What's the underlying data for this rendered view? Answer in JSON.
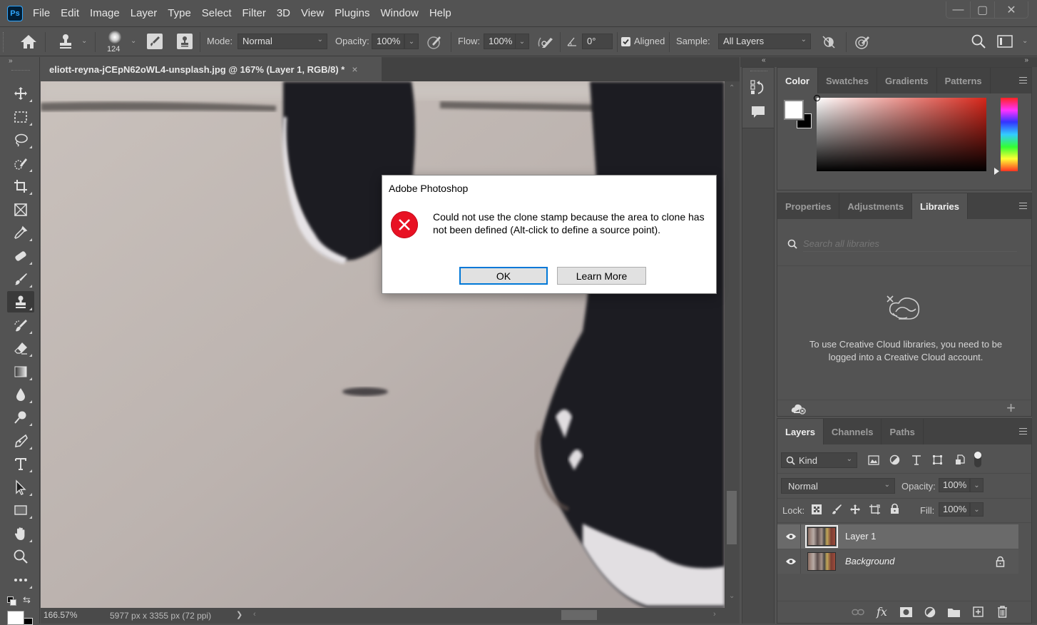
{
  "app": {
    "logo": "Ps",
    "name": "Adobe Photoshop"
  },
  "menu": [
    "File",
    "Edit",
    "Image",
    "Layer",
    "Type",
    "Select",
    "Filter",
    "3D",
    "View",
    "Plugins",
    "Window",
    "Help"
  ],
  "window_controls": {
    "minimize": "—",
    "maximize": "▢",
    "close": "✕"
  },
  "options": {
    "brush_size": "124",
    "mode_label": "Mode:",
    "mode_value": "Normal",
    "opacity_label": "Opacity:",
    "opacity_value": "100%",
    "flow_label": "Flow:",
    "flow_value": "100%",
    "angle_value": "0°",
    "aligned_label": "Aligned",
    "aligned_checked": true,
    "sample_label": "Sample:",
    "sample_value": "All Layers"
  },
  "document": {
    "tab_title": "eliott-reyna-jCEpN62oWL4-unsplash.jpg @ 167% (Layer 1, RGB/8) *",
    "close": "×",
    "zoom": "166.57%",
    "dimensions": "5977 px x 3355 px (72 ppi)",
    "status_arrow": "❯"
  },
  "tools": [
    {
      "name": "move-tool",
      "active": false
    },
    {
      "name": "rectangular-marquee-tool",
      "active": false
    },
    {
      "name": "lasso-tool",
      "active": false
    },
    {
      "name": "object-selection-tool",
      "active": false
    },
    {
      "name": "crop-tool",
      "active": false
    },
    {
      "name": "frame-tool",
      "active": false
    },
    {
      "name": "eyedropper-tool",
      "active": false
    },
    {
      "name": "spot-healing-tool",
      "active": false
    },
    {
      "name": "brush-tool",
      "active": false
    },
    {
      "name": "clone-stamp-tool",
      "active": true
    },
    {
      "name": "history-brush-tool",
      "active": false
    },
    {
      "name": "eraser-tool",
      "active": false
    },
    {
      "name": "gradient-tool",
      "active": false
    },
    {
      "name": "blur-tool",
      "active": false
    },
    {
      "name": "dodge-tool",
      "active": false
    },
    {
      "name": "pen-tool",
      "active": false
    },
    {
      "name": "type-tool",
      "active": false
    },
    {
      "name": "path-selection-tool",
      "active": false
    },
    {
      "name": "rectangle-tool",
      "active": false
    },
    {
      "name": "hand-tool",
      "active": false
    },
    {
      "name": "zoom-tool",
      "active": false
    },
    {
      "name": "edit-toolbar",
      "active": false
    }
  ],
  "colors": {
    "foreground": "#ffffff",
    "background": "#000000",
    "accent": "#0078d7",
    "error": "#e81123"
  },
  "dialog": {
    "title": "Adobe Photoshop",
    "message": "Could not use the clone stamp because the area to clone has not been defined (Alt-click to define a source point).",
    "ok_label": "OK",
    "learn_more_label": "Learn More"
  },
  "color_panel": {
    "tabs": [
      "Color",
      "Swatches",
      "Gradients",
      "Patterns"
    ],
    "active_tab": "Color",
    "hue": "#d6261a"
  },
  "libraries_panel": {
    "tabs": [
      "Properties",
      "Adjustments",
      "Libraries"
    ],
    "active_tab": "Libraries",
    "search_placeholder": "Search all libraries",
    "message": "To use Creative Cloud libraries, you need to be logged into a Creative Cloud account."
  },
  "layers_panel": {
    "tabs": [
      "Layers",
      "Channels",
      "Paths"
    ],
    "active_tab": "Layers",
    "filter_label": "Kind",
    "blend_mode": "Normal",
    "opacity_label": "Opacity:",
    "opacity_value": "100%",
    "lock_label": "Lock:",
    "fill_label": "Fill:",
    "fill_value": "100%",
    "layers": [
      {
        "name": "Layer 1",
        "visible": true,
        "selected": true,
        "locked": false
      },
      {
        "name": "Background",
        "visible": true,
        "selected": false,
        "locked": true
      }
    ]
  }
}
